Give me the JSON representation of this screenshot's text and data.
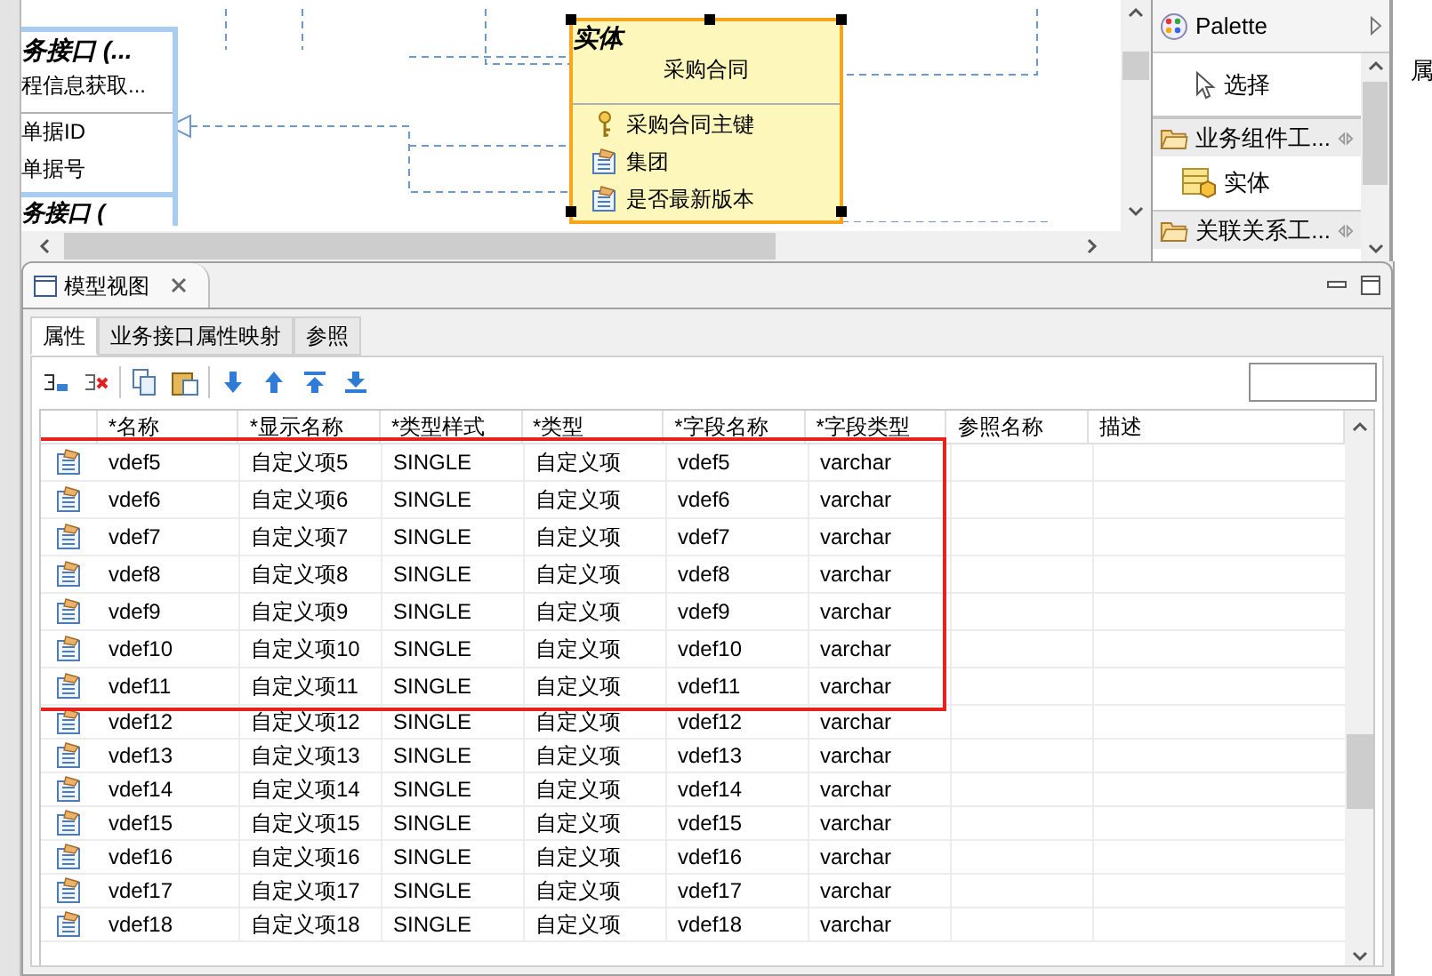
{
  "diagram": {
    "interface_node": {
      "title": "务接口 (...",
      "operations": [
        "程信息获取..."
      ],
      "attributes": [
        "单据ID",
        "单据号"
      ]
    },
    "interface_node_2": {
      "title": "务接口 ("
    },
    "entity": {
      "stereotype": "实体",
      "name": "采购合同",
      "selected": true,
      "attributes": [
        {
          "kind": "key",
          "label": "采购合同主键"
        },
        {
          "kind": "field",
          "label": "集团"
        },
        {
          "kind": "field",
          "label": "是否最新版本"
        }
      ]
    }
  },
  "palette": {
    "title": "Palette",
    "items": [
      {
        "kind": "tool",
        "label": "选择"
      },
      {
        "kind": "drawer",
        "label": "业务组件工..."
      },
      {
        "kind": "entity",
        "label": "实体"
      },
      {
        "kind": "drawer",
        "label": "关联关系工..."
      }
    ]
  },
  "side_strip": {
    "label": "属"
  },
  "model_view": {
    "title": "模型视图",
    "tabs": [
      {
        "label": "属性",
        "selected": true
      },
      {
        "label": "业务接口属性映射",
        "selected": false
      },
      {
        "label": "参照",
        "selected": false
      }
    ],
    "table": {
      "columns": [
        "*名称",
        "*显示名称",
        "*类型样式",
        "*类型",
        "*字段名称",
        "*字段类型",
        "参照名称",
        "描述"
      ],
      "rows": [
        {
          "name": "vdef5",
          "display_name": "自定义项5",
          "type_style": "SINGLE",
          "type": "自定义项",
          "field_name": "vdef5",
          "field_type": "varchar",
          "annotated": true
        },
        {
          "name": "vdef6",
          "display_name": "自定义项6",
          "type_style": "SINGLE",
          "type": "自定义项",
          "field_name": "vdef6",
          "field_type": "varchar",
          "annotated": true
        },
        {
          "name": "vdef7",
          "display_name": "自定义项7",
          "type_style": "SINGLE",
          "type": "自定义项",
          "field_name": "vdef7",
          "field_type": "varchar",
          "annotated": true
        },
        {
          "name": "vdef8",
          "display_name": "自定义项8",
          "type_style": "SINGLE",
          "type": "自定义项",
          "field_name": "vdef8",
          "field_type": "varchar",
          "annotated": true
        },
        {
          "name": "vdef9",
          "display_name": "自定义项9",
          "type_style": "SINGLE",
          "type": "自定义项",
          "field_name": "vdef9",
          "field_type": "varchar",
          "annotated": true
        },
        {
          "name": "vdef10",
          "display_name": "自定义项10",
          "type_style": "SINGLE",
          "type": "自定义项",
          "field_name": "vdef10",
          "field_type": "varchar",
          "annotated": true
        },
        {
          "name": "vdef11",
          "display_name": "自定义项11",
          "type_style": "SINGLE",
          "type": "自定义项",
          "field_name": "vdef11",
          "field_type": "varchar",
          "annotated": true
        },
        {
          "name": "vdef12",
          "display_name": "自定义项12",
          "type_style": "SINGLE",
          "type": "自定义项",
          "field_name": "vdef12",
          "field_type": "varchar",
          "annotated": false
        },
        {
          "name": "vdef13",
          "display_name": "自定义项13",
          "type_style": "SINGLE",
          "type": "自定义项",
          "field_name": "vdef13",
          "field_type": "varchar",
          "annotated": false
        },
        {
          "name": "vdef14",
          "display_name": "自定义项14",
          "type_style": "SINGLE",
          "type": "自定义项",
          "field_name": "vdef14",
          "field_type": "varchar",
          "annotated": false
        },
        {
          "name": "vdef15",
          "display_name": "自定义项15",
          "type_style": "SINGLE",
          "type": "自定义项",
          "field_name": "vdef15",
          "field_type": "varchar",
          "annotated": false
        },
        {
          "name": "vdef16",
          "display_name": "自定义项16",
          "type_style": "SINGLE",
          "type": "自定义项",
          "field_name": "vdef16",
          "field_type": "varchar",
          "annotated": false
        },
        {
          "name": "vdef17",
          "display_name": "自定义项17",
          "type_style": "SINGLE",
          "type": "自定义项",
          "field_name": "vdef17",
          "field_type": "varchar",
          "annotated": false
        },
        {
          "name": "vdef18",
          "display_name": "自定义项18",
          "type_style": "SINGLE",
          "type": "自定义项",
          "field_name": "vdef18",
          "field_type": "varchar",
          "annotated": false
        }
      ]
    }
  }
}
